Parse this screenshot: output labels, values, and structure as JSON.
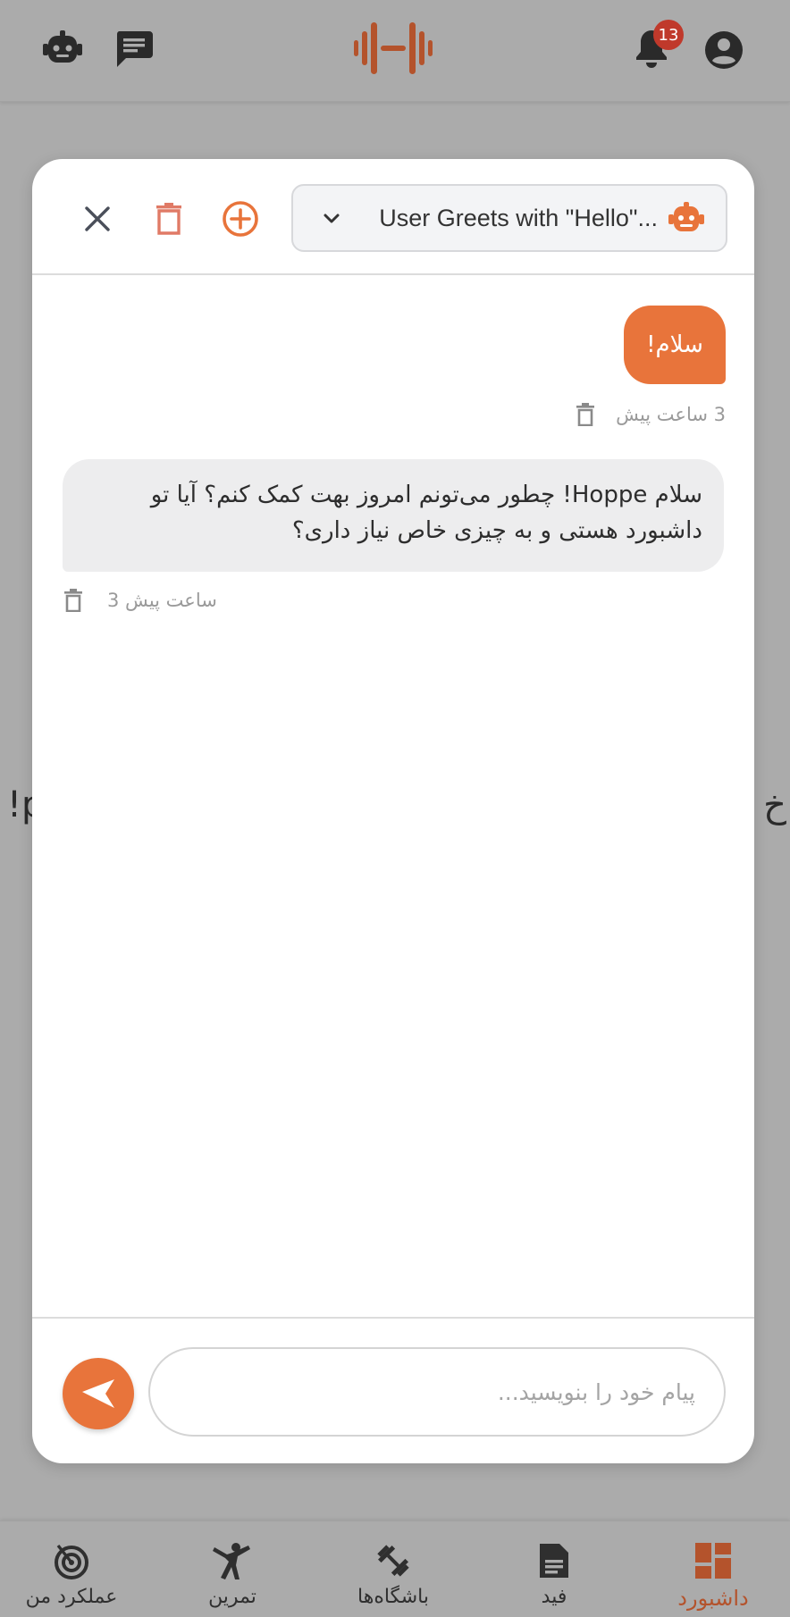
{
  "topbar": {
    "notification_count": "13",
    "icons": [
      "robot-icon",
      "chat-icon",
      "barbell-logo",
      "bell-icon",
      "account-icon"
    ]
  },
  "background": {
    "text_left": "!p",
    "text_right": "خ"
  },
  "chat": {
    "conversation_title": "User Greets with \"Hello\"...",
    "messages": [
      {
        "role": "user",
        "text": "سلام!",
        "time": "3 ساعت پیش"
      },
      {
        "role": "assistant",
        "text": "سلام Hoppe! چطور می‌تونم امروز بهت کمک کنم؟ آیا تو داشبورد هستی و به چیزی خاص نیاز داری؟",
        "time": "3 ساعت پیش"
      }
    ],
    "input_placeholder": "پیام خود را بنویسید...",
    "input_value": ""
  },
  "bottom_nav": {
    "items": [
      {
        "label": "عملکرد من",
        "icon": "target-icon",
        "active": false
      },
      {
        "label": "تمرین",
        "icon": "exercise-icon",
        "active": false
      },
      {
        "label": "باشگاه‌ها",
        "icon": "dumbbell-icon",
        "active": false
      },
      {
        "label": "فید",
        "icon": "document-icon",
        "active": false
      },
      {
        "label": "داشبورد",
        "icon": "dashboard-icon",
        "active": true
      }
    ]
  },
  "colors": {
    "accent": "#e8743b",
    "dark_accent": "#b4532c",
    "overlay_bg": "#ababab",
    "badge": "#c0392b",
    "delete": "#e07a66"
  }
}
